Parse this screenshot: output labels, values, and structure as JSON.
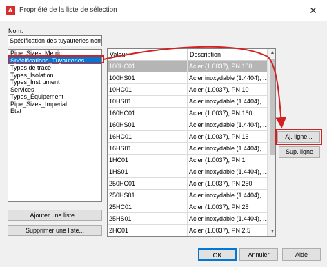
{
  "window": {
    "title": "Propriété de la liste de sélection",
    "app_icon": "A",
    "close": "✕"
  },
  "name_label": "Nom:",
  "name_value": "Spécification des tuyauteries nomin",
  "lists": [
    "Pipe_Sizes_Metric",
    "Spécifications_Tuyauteries",
    "Types de tracé",
    "Types_Isolation",
    "Types_Instrument",
    "Services",
    "Types_Équipement",
    "Pipe_Sizes_Imperial",
    "État"
  ],
  "buttons": {
    "add_list": "Ajouter une liste...",
    "delete_list": "Supprimer une liste...",
    "add_row": "Aj. ligne...",
    "delete_row": "Sup. ligne",
    "ok": "OK",
    "cancel": "Annuler",
    "help": "Aide"
  },
  "table": {
    "headers": [
      "Valeur",
      "Description"
    ],
    "rows": [
      [
        "100HC01",
        "Acier (1.0037), PN 100"
      ],
      [
        "100HS01",
        "Acier inoxydable (1.4404), ..."
      ],
      [
        "10HC01",
        "Acier (1.0037), PN 10"
      ],
      [
        "10HS01",
        "Acier inoxydable (1.4404), ..."
      ],
      [
        "160HC01",
        "Acier (1.0037), PN 160"
      ],
      [
        "160HS01",
        "Acier inoxydable (1.4404), ..."
      ],
      [
        "16HC01",
        "Acier (1.0037), PN 16"
      ],
      [
        "16HS01",
        "Acier inoxydable (1.4404), ..."
      ],
      [
        "1HC01",
        "Acier (1.0037), PN 1"
      ],
      [
        "1HS01",
        "Acier inoxydable (1.4404), ..."
      ],
      [
        "250HC01",
        "Acier (1.0037), PN 250"
      ],
      [
        "250HS01",
        "Acier inoxydable (1.4404), ..."
      ],
      [
        "25HC01",
        "Acier (1.0037), PN 25"
      ],
      [
        "25HS01",
        "Acier inoxydable (1.4404), ..."
      ],
      [
        "2HC01",
        "Acier (1.0037), PN 2.5"
      ]
    ]
  },
  "colors": {
    "highlight": "#d32020",
    "selection": "#0078d7",
    "dialog_bg": "#f0f0f0"
  }
}
